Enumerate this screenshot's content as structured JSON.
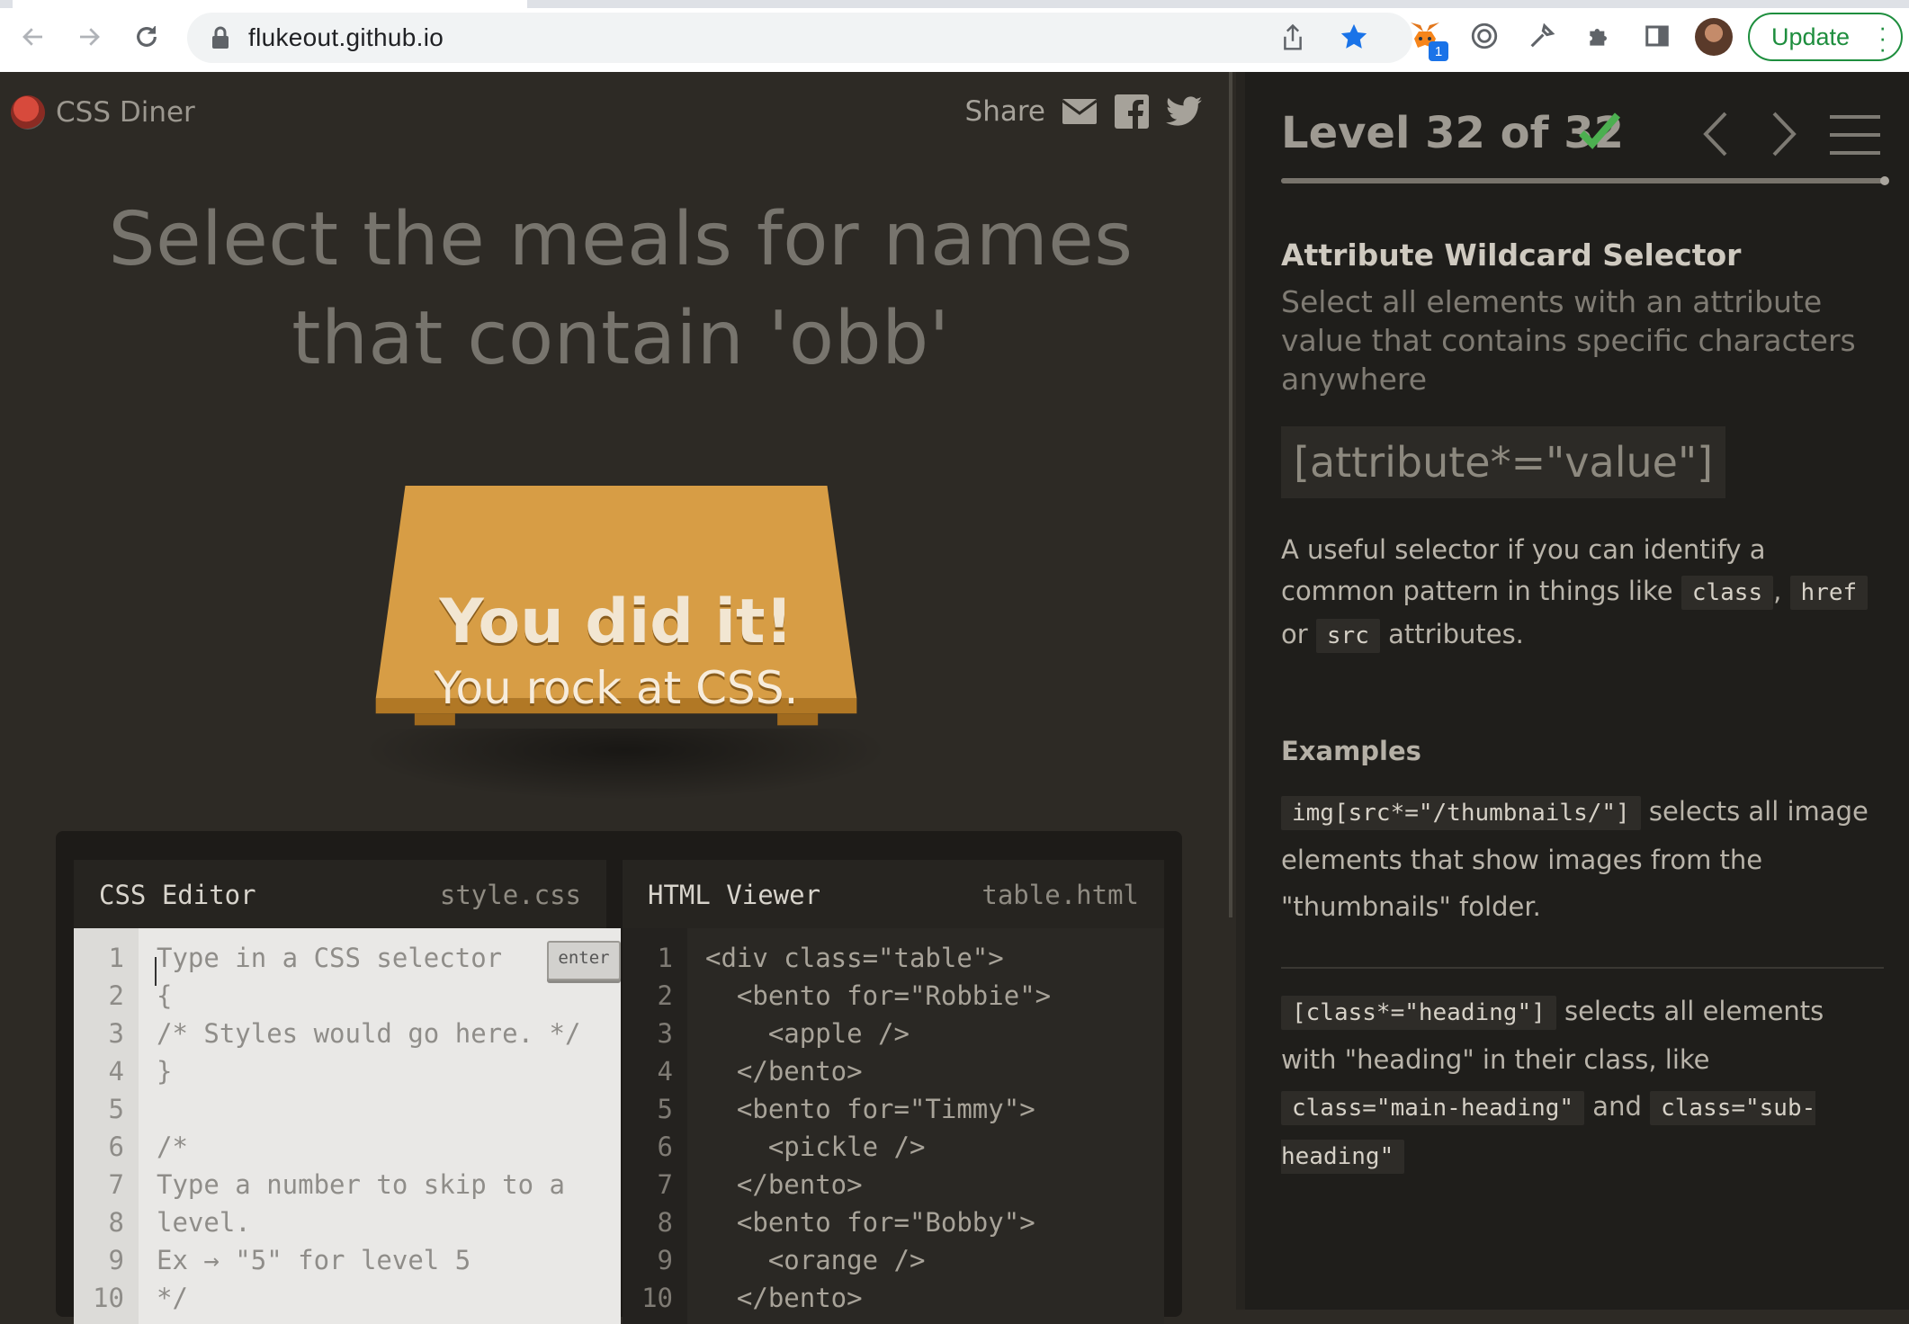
{
  "browser": {
    "url": "flukeout.github.io",
    "extension_badge": "1",
    "update_label": "Update"
  },
  "game": {
    "app_name": "CSS Diner",
    "share_label": "Share",
    "order": "Select the meals for names that contain 'obb'",
    "table_message_title": "You did it!",
    "table_message_sub": "You rock at CSS.",
    "colors": {
      "table": "#d79d45",
      "background": "#2d2a25",
      "check": "#4caf50"
    }
  },
  "editor": {
    "css_title": "CSS Editor",
    "css_file": "style.css",
    "html_title": "HTML Viewer",
    "html_file": "table.html",
    "enter_label": "enter",
    "css_lines": [
      {
        "n": "1",
        "text": "Type in a CSS selector"
      },
      {
        "n": "2",
        "text": "{"
      },
      {
        "n": "3",
        "text": "/* Styles would go here. */"
      },
      {
        "n": "4",
        "text": "}"
      },
      {
        "n": "5",
        "text": ""
      },
      {
        "n": "6",
        "text": "/*"
      },
      {
        "n": "7",
        "text": "Type a number to skip to a"
      },
      {
        "n": "8",
        "text": "level."
      },
      {
        "n": "9",
        "text": "Ex → \"5\" for level 5"
      },
      {
        "n": "10",
        "text": "*/"
      }
    ],
    "html_lines": [
      {
        "n": "1",
        "text": "<div class=\"table\">"
      },
      {
        "n": "2",
        "text": "  <bento for=\"Robbie\">"
      },
      {
        "n": "3",
        "text": "    <apple />"
      },
      {
        "n": "4",
        "text": "  </bento>"
      },
      {
        "n": "5",
        "text": "  <bento for=\"Timmy\">"
      },
      {
        "n": "6",
        "text": "    <pickle />"
      },
      {
        "n": "7",
        "text": "  </bento>"
      },
      {
        "n": "8",
        "text": "  <bento for=\"Bobby\">"
      },
      {
        "n": "9",
        "text": "    <orange />"
      },
      {
        "n": "10",
        "text": "  </bento>"
      }
    ]
  },
  "sidebar": {
    "level_title": "Level 32 of 32",
    "progress_fraction": 1.0,
    "selector_name": "Attribute Wildcard Selector",
    "selector_title": "Select all elements with an attribute value that contains specific characters anywhere",
    "syntax": "[attribute*=\"value\"]",
    "hint_before": "A useful selector if you can identify a common pattern in things like",
    "hint_code1": "class",
    "hint_sep1": ",",
    "hint_code2": "href",
    "hint_or": "or",
    "hint_code3": "src",
    "hint_after": "attributes.",
    "examples_heading": "Examples",
    "example1_code": "img[src*=\"/thumbnails/\"]",
    "example1_text": "selects all image elements that show images from the \"thumbnails\" folder.",
    "example2_code": "[class*=\"heading\"]",
    "example2_text": "selects all elements with \"heading\" in their class, like",
    "example2_code2": "class=\"main-heading\"",
    "example2_and": "and",
    "example2_code3": "class=\"sub-heading\""
  }
}
